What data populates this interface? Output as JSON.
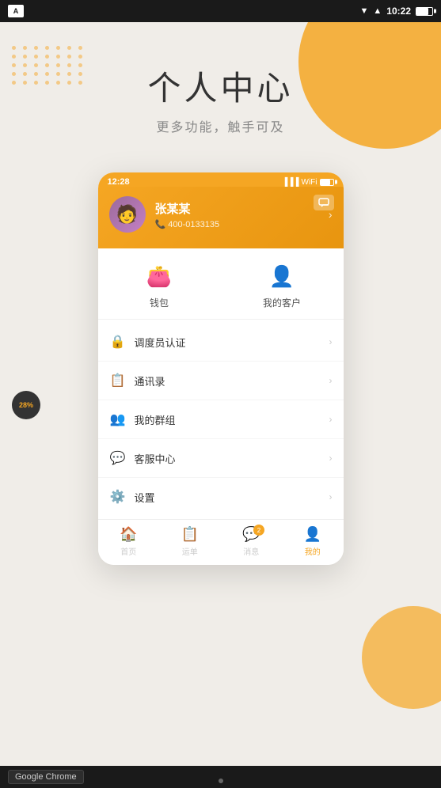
{
  "statusBar": {
    "appIcon": "A",
    "time": "10:22",
    "battery": 75
  },
  "background": {
    "title": "个人中心",
    "subtitle": "更多功能，触手可及"
  },
  "phone": {
    "time": "12:28",
    "profile": {
      "name": "张某某",
      "phone": "400-0133135"
    },
    "quickActions": [
      {
        "label": "钱包",
        "icon": "👛"
      },
      {
        "label": "我的客户",
        "icon": "👤"
      }
    ],
    "menuItems": [
      {
        "label": "调度员认证",
        "icon": "🔒"
      },
      {
        "label": "通讯录",
        "icon": "📋"
      },
      {
        "label": "我的群组",
        "icon": "👥"
      },
      {
        "label": "客服中心",
        "icon": "💬"
      },
      {
        "label": "设置",
        "icon": "⚙️"
      }
    ],
    "bottomNav": [
      {
        "label": "首页",
        "icon": "🏠",
        "active": false
      },
      {
        "label": "运单",
        "icon": "📋",
        "active": false
      },
      {
        "label": "消息",
        "icon": "💬",
        "active": false,
        "badge": "2"
      },
      {
        "label": "我的",
        "icon": "👤",
        "active": true
      }
    ]
  },
  "taskbar": {
    "appName": "Google Chrome"
  },
  "progressBadge": "28%",
  "dots": [
    1,
    2,
    3,
    4,
    5,
    6,
    7,
    8,
    9,
    10,
    11,
    12,
    13,
    14,
    15,
    16,
    17,
    18,
    19,
    20,
    21
  ]
}
